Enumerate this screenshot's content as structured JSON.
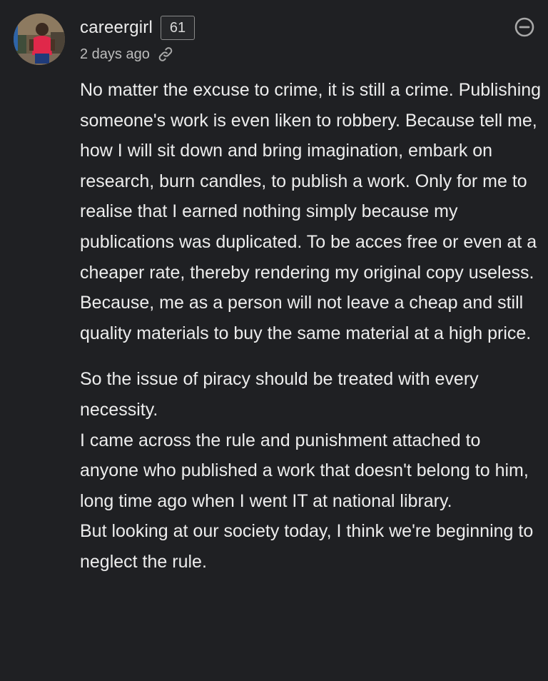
{
  "comment": {
    "author": {
      "username": "careergirl",
      "reputation": "61",
      "avatar_icon": "user-avatar-photo"
    },
    "timestamp": "2 days ago",
    "icons": {
      "permalink": "link-icon",
      "collapse": "minus-circle-icon"
    },
    "paragraphs": [
      "No matter the excuse to crime, it is still a crime. Publishing someone's work is even liken to robbery. Because tell me, how I will sit down and bring imagination, embark on research, burn candles, to publish a work. Only for me to realise that I earned nothing simply because my publications was duplicated. To be acces free or even at a cheaper rate, thereby rendering my original copy useless. Because, me as a person will not leave a cheap and still quality materials to buy the same material at a high price.",
      "So the issue of piracy should be treated with every necessity.",
      "I came across the rule and punishment attached to anyone who published a work that doesn't belong to him, long time ago when I went IT at national library.",
      "But looking at our society today, I think we're beginning to neglect the rule."
    ]
  },
  "colors": {
    "background": "#1f2023",
    "text": "#ededed",
    "muted_text": "#bdbdbd",
    "badge_border": "#8a8a8a",
    "icon": "#a9a9a9"
  }
}
